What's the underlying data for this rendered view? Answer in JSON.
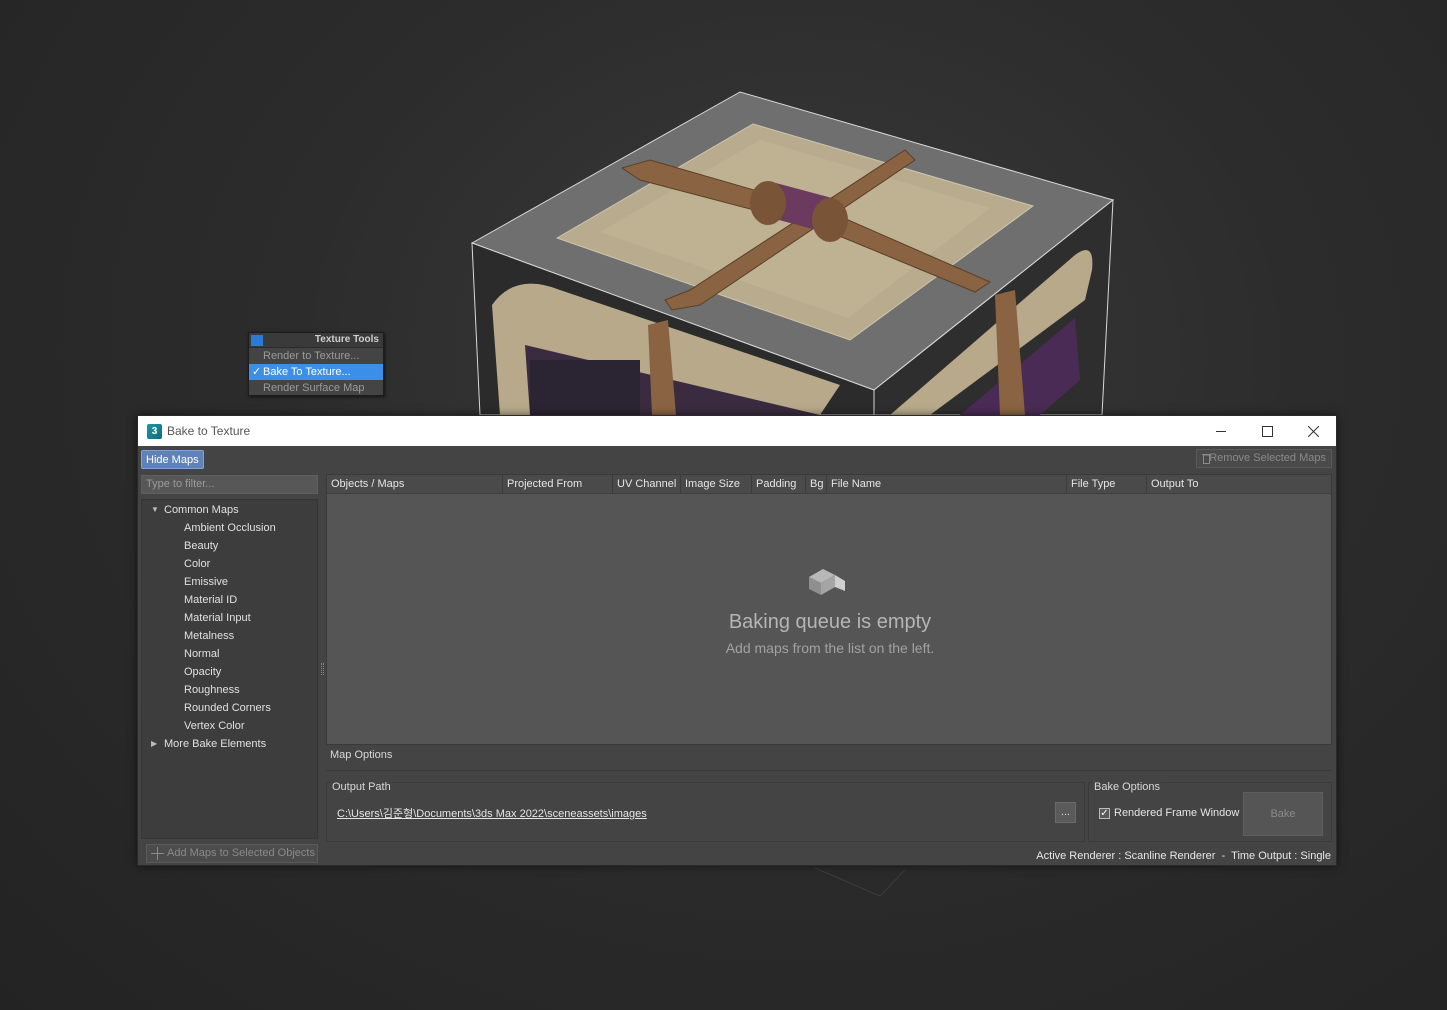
{
  "quad_menu": {
    "header": "Texture Tools",
    "items": [
      {
        "label": "Render to Texture...",
        "selected": false
      },
      {
        "label": "Bake To Texture...",
        "selected": true
      },
      {
        "label": "Render Surface Map",
        "selected": false
      }
    ]
  },
  "dialog": {
    "app_icon": "3",
    "title": "Bake to Texture",
    "hide_maps_label": "Hide Maps",
    "remove_selected_label": "Remove Selected Maps",
    "filter_placeholder": "Type to filter...",
    "tree": {
      "common_group": "Common Maps",
      "common_items": [
        "Ambient Occlusion",
        "Beauty",
        "Color",
        "Emissive",
        "Material ID",
        "Material Input",
        "Metalness",
        "Normal",
        "Opacity",
        "Roughness",
        "Rounded Corners",
        "Vertex Color"
      ],
      "more_group": "More Bake Elements"
    },
    "add_maps_label": "Add Maps to Selected Objects",
    "table": {
      "columns": [
        "Objects / Maps",
        "Projected From",
        "UV Channel",
        "Image Size",
        "Padding",
        "Bg",
        "File Name",
        "File Type",
        "Output To"
      ],
      "empty_title": "Baking queue is empty",
      "empty_subtitle": "Add maps from the list on the left."
    },
    "map_options_label": "Map Options",
    "output_path_label": "Output Path",
    "output_path_value": "C:\\Users\\김준형\\Documents\\3ds Max 2022\\sceneassets\\images",
    "browse_label": "...",
    "bake_options_label": "Bake Options",
    "rendered_frame_window_label": "Rendered Frame Window",
    "rendered_frame_window_checked": true,
    "bake_button_label": "Bake",
    "status_text": "Active Renderer : Scanline Renderer  -  Time Output : Single"
  },
  "colors": {
    "accent": "#3c8fe8",
    "hide_maps_bg": "#5f83b8",
    "dialog_bg": "#444444",
    "viewport_bg": "#2c2c2c"
  },
  "icons": {
    "app": "3ds-max-app-icon",
    "minimize": "minimize-icon",
    "maximize": "maximize-icon",
    "close": "close-icon",
    "trash": "trash-icon",
    "add": "add-icon",
    "empty_queue": "empty-box-icon",
    "check": "checkmark-icon"
  }
}
